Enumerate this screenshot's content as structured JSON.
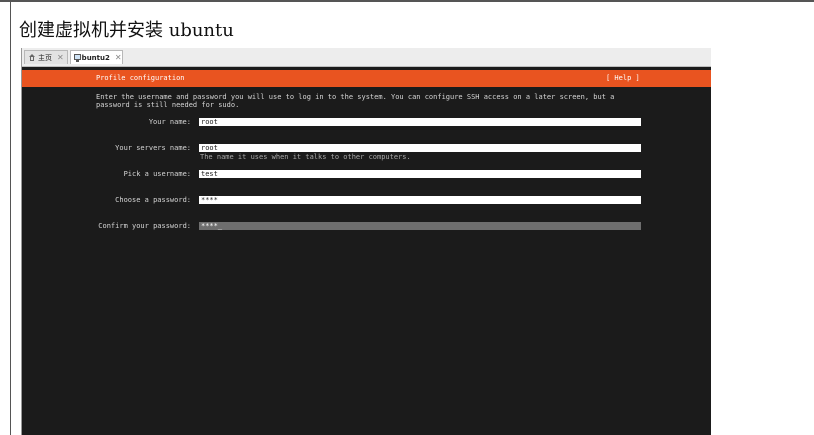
{
  "page": {
    "heading": "创建虚拟机并安装 ubuntu"
  },
  "tabs": [
    {
      "label": "主页",
      "icon": "home-icon",
      "active": false
    },
    {
      "label": "Ubuntu2",
      "icon": "vm-icon",
      "active": true
    }
  ],
  "installer": {
    "title": "Profile configuration",
    "help_label": "[ Help ]",
    "intro": "Enter the username and password you will use to log in to the system. You can configure SSH access on a later screen, but a password is still needed for sudo.",
    "fields": {
      "your_name": {
        "label": "Your name:",
        "value": "root"
      },
      "server_name": {
        "label": "Your servers name:",
        "value": "root",
        "hint": "The name it uses when it talks to other computers."
      },
      "username": {
        "label": "Pick a username:",
        "value": "test"
      },
      "password": {
        "label": "Choose a password:",
        "value": "****"
      },
      "confirm_password": {
        "label": "Confirm your password:",
        "value": "****_"
      }
    }
  },
  "colors": {
    "accent": "#e95420",
    "terminal_bg": "#1b1b1b",
    "focused_field": "#6e6e6e"
  }
}
